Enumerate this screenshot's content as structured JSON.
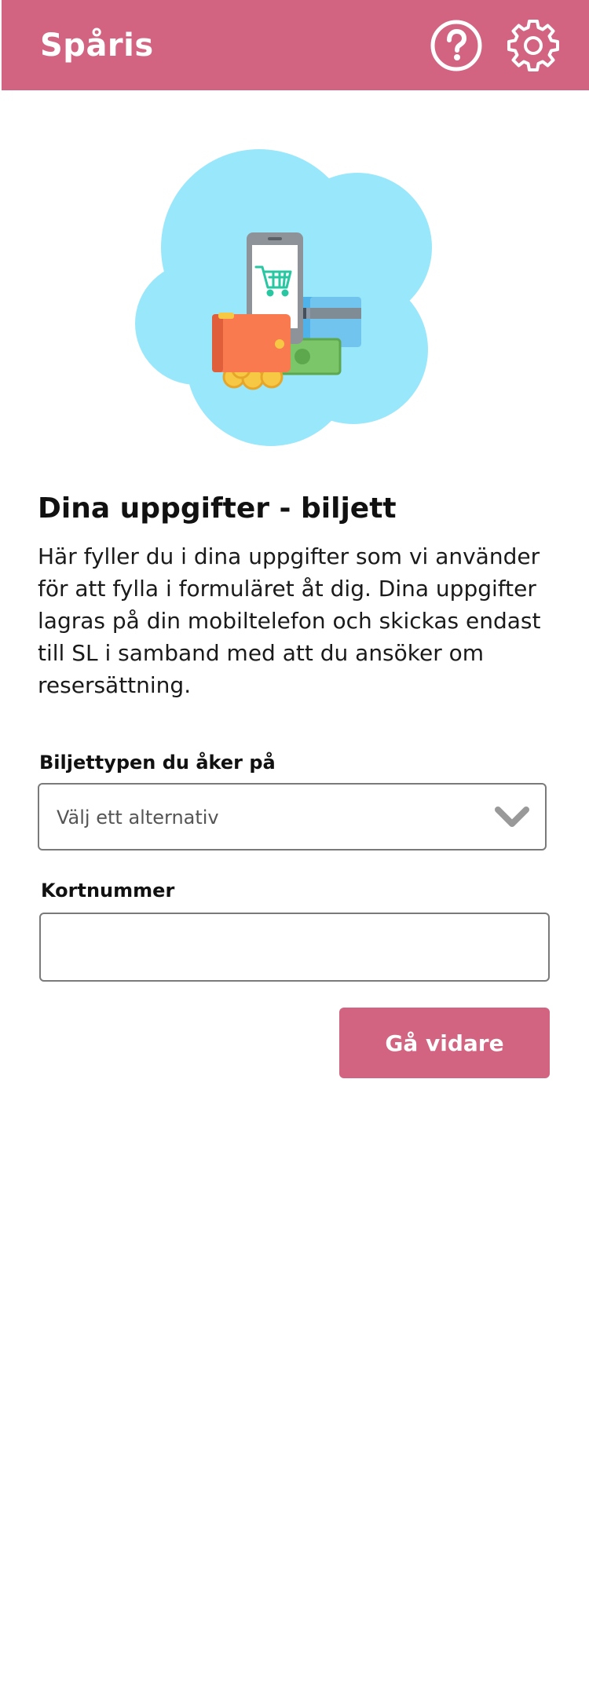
{
  "header": {
    "title": "Spåris",
    "help_icon": "question-circle-icon",
    "settings_icon": "gear-icon",
    "background_color": "#d26381"
  },
  "hero": {
    "illustration": "wallet-phone-cart-card-illustration"
  },
  "main": {
    "title": "Dina uppgifter - biljett",
    "intro": "Här fyller du i dina uppgifter som vi använder för att fylla i formuläret åt dig. Dina uppgifter lagras på din mobiltelefon och skickas endast till SL i samband med att du ansöker om resersättning."
  },
  "form": {
    "ticket_type": {
      "label": "Biljettypen du åker på",
      "value": "Välj ett alternativ",
      "icon": "chevron-down-icon"
    },
    "card_number": {
      "label": "Kortnummer",
      "value": "",
      "placeholder": ""
    },
    "submit_label": "Gå vidare"
  },
  "colors": {
    "accent": "#d26381",
    "cloud": "#99e7fb"
  }
}
